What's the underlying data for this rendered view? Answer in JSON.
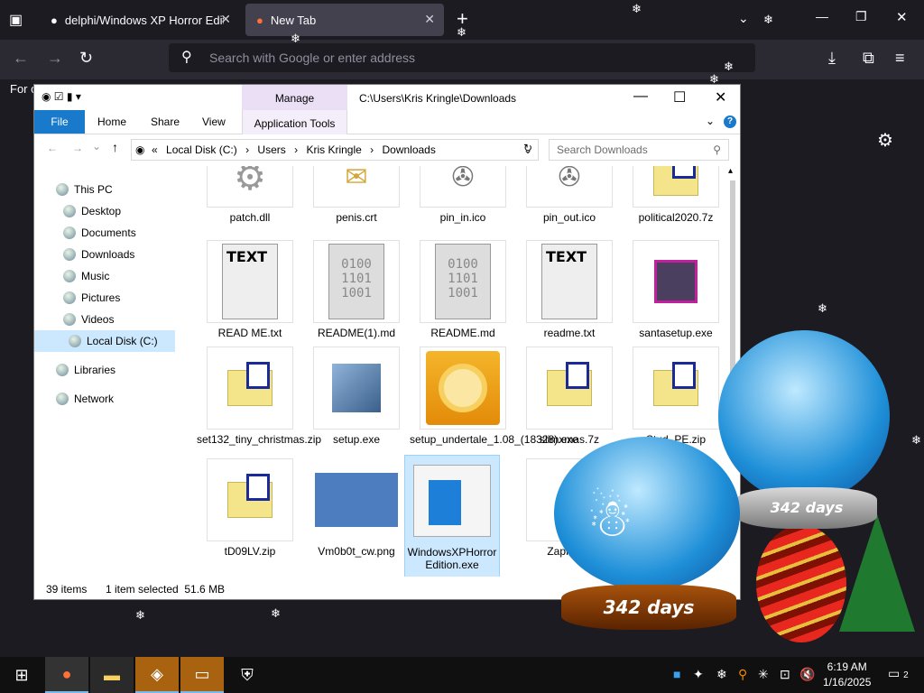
{
  "browser": {
    "tabs": [
      {
        "title": "delphi/Windows XP Horror Edit",
        "close": "✕"
      },
      {
        "title": "New Tab",
        "close": "✕"
      }
    ],
    "new_tab_symbol": "+",
    "url_placeholder": "Search with Google or enter address",
    "page_fragment": "For c"
  },
  "explorer": {
    "title_path": "C:\\Users\\Kris Kringle\\Downloads",
    "manage_tab": "Manage",
    "ribbon_tabs": [
      "File",
      "Home",
      "Share",
      "View",
      "Application Tools"
    ],
    "breadcrumb": [
      "Local Disk (C:)",
      "Users",
      "Kris Kringle",
      "Downloads"
    ],
    "breadcrumb_prefix": "«",
    "search_placeholder": "Search Downloads",
    "nav": {
      "this_pc": "This PC",
      "items": [
        "Desktop",
        "Documents",
        "Downloads",
        "Music",
        "Pictures",
        "Videos",
        "Local Disk (C:)"
      ],
      "libraries": "Libraries",
      "network": "Network"
    },
    "files": [
      "patch.dll",
      "penis.crt",
      "pin_in.ico",
      "pin_out.ico",
      "political2020.7z",
      "READ ME.txt",
      "README(1).md",
      "README.md",
      "readme.txt",
      "santasetup.exe",
      "set132_tiny_christmas.zip",
      "setup.exe",
      "setup_undertale_1.08_(18328).exe",
      "slimxmas.7z",
      "Stud_PE.zip",
      "tD09LV.zip",
      "Vm0b0t_cw.png",
      "WindowsXPHorrorEdition.exe",
      "ZapMess"
    ],
    "status": {
      "count": "39 items",
      "selection": "1 item selected  51.6 MB"
    },
    "icon_text": {
      "txt": "TEXT",
      "binary": "0100\n1101\n1001"
    }
  },
  "globes": {
    "days_label": "342 days"
  },
  "taskbar": {
    "time": "6:19 AM",
    "date": "1/16/2025",
    "notifications": "2"
  },
  "colors": {
    "accent": "#1979ca",
    "selection": "#cce8ff",
    "manage": "#eadff5"
  }
}
